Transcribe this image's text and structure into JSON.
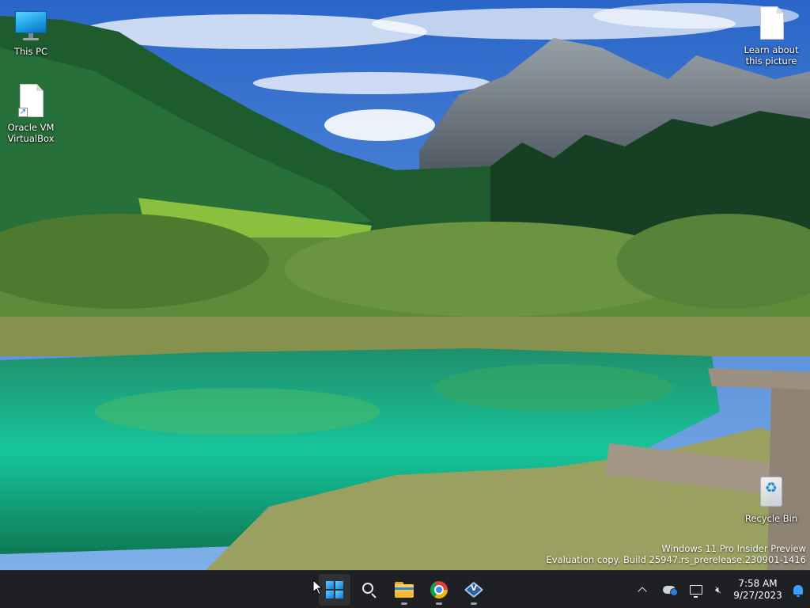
{
  "desktop": {
    "icons": [
      {
        "label": "This PC",
        "icon": "computer-icon"
      },
      {
        "label": "Oracle VM VirtualBox",
        "icon": "shortcut-file-icon"
      },
      {
        "label": "Learn about this picture",
        "icon": "file-icon"
      },
      {
        "label": "Recycle Bin",
        "icon": "recycle-bin-icon"
      }
    ],
    "watermark": {
      "line1": "Windows 11 Pro Insider Preview",
      "line2": "Evaluation copy. Build 25947.rs_prerelease.230901-1416"
    }
  },
  "taskbar": {
    "apps": [
      {
        "name": "Start",
        "icon": "windows-logo-icon"
      },
      {
        "name": "Search",
        "icon": "search-icon"
      },
      {
        "name": "File Explorer",
        "icon": "folder-icon"
      },
      {
        "name": "Google Chrome",
        "icon": "chrome-icon"
      },
      {
        "name": "Oracle VM VirtualBox",
        "icon": "virtualbox-icon"
      }
    ],
    "tray": {
      "time": "7:58 AM",
      "date": "9/27/2023"
    }
  },
  "colors": {
    "taskbar_bg": "#1f2023",
    "accent": "#0f7bd9",
    "notification": "#3aa0ff"
  }
}
